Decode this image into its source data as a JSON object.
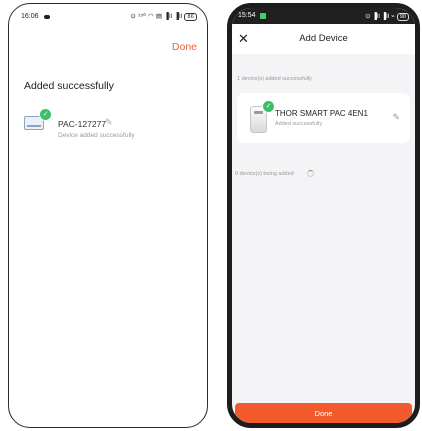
{
  "left_screen": {
    "status_bar": {
      "time": "16:06",
      "system_icons": "⊙ ¹⁵⁰ ◠ ▤ ▐ll ▐ll",
      "battery": "86"
    },
    "done_label": "Done",
    "heading": "Added successfully",
    "device": {
      "name": "PAC-127277",
      "status": "Device added successfully",
      "icon": "air-conditioner-icon",
      "badge_icon": "check-badge-icon"
    }
  },
  "right_screen": {
    "status_bar": {
      "time": "15:54",
      "system_icons": "⊙ ▐ll ▐ll ⌁",
      "battery": "90"
    },
    "title": "Add Device",
    "close_icon": "close-icon",
    "added_count_label": "1 device(s) added successfully",
    "device": {
      "name": "THOR SMART PAC 4EN1",
      "status": "Added successfully",
      "icon": "portable-ac-icon"
    },
    "adding_label": "0 device(s) being added",
    "done_button_label": "Done"
  },
  "colors": {
    "accent": "#f25a2b",
    "success_green": "#3cc16a",
    "done_text": "#e8633c"
  }
}
